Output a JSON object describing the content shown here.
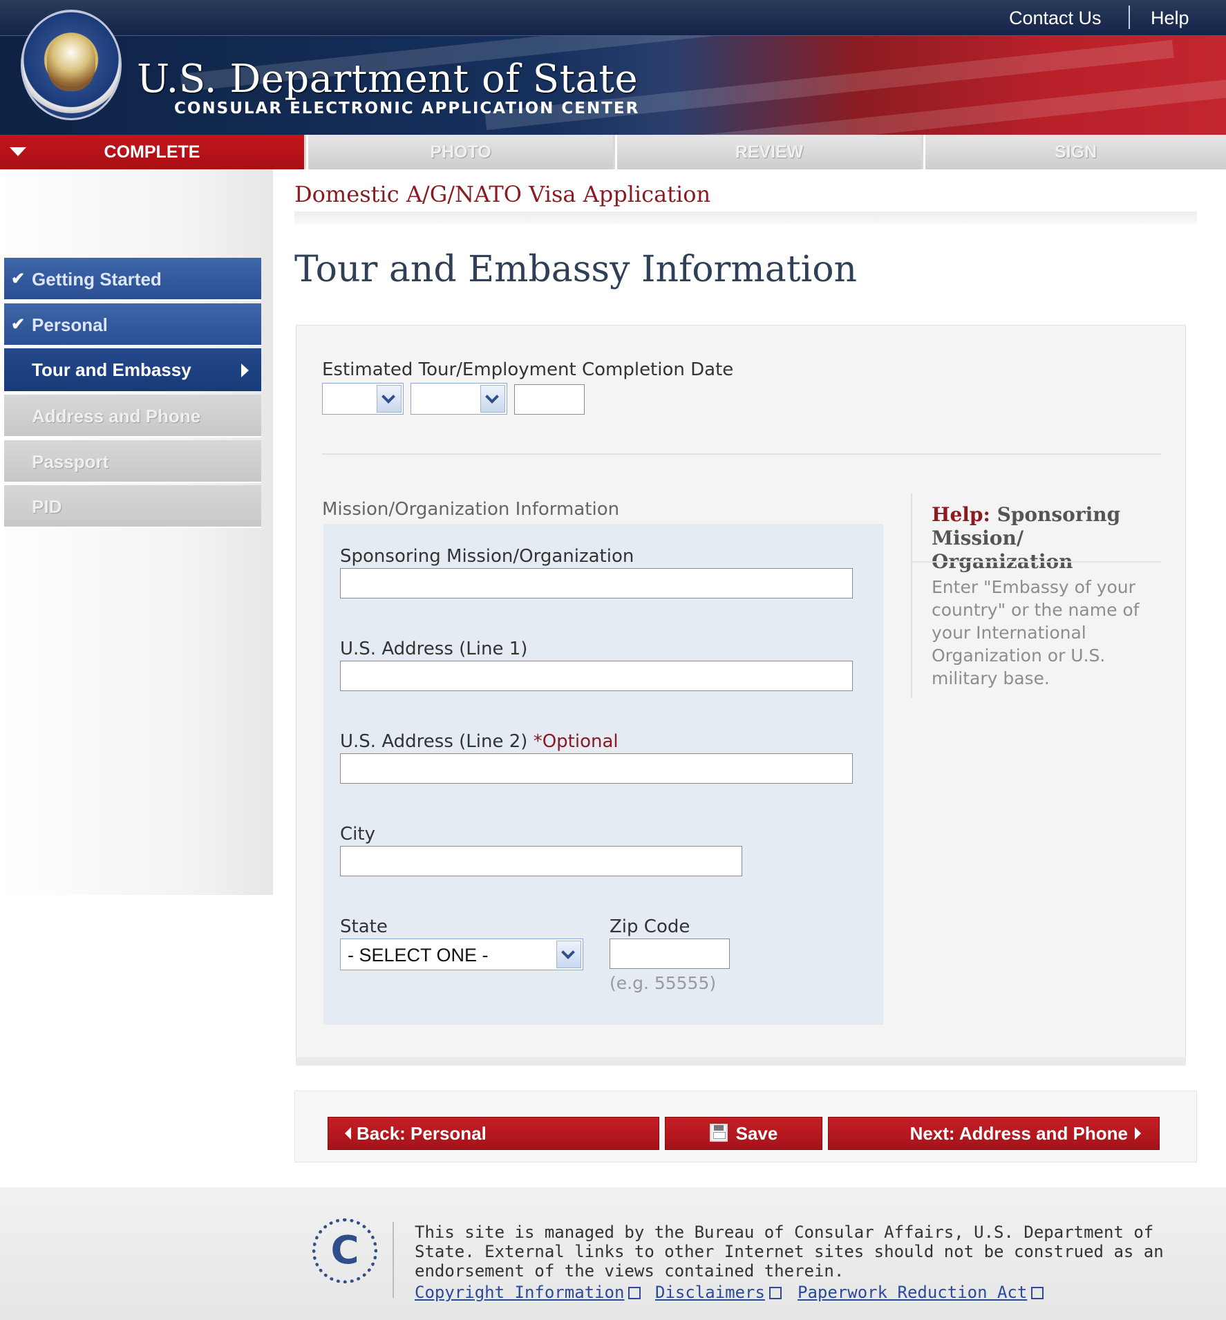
{
  "header": {
    "agency_title": "U.S. Department of State",
    "agency_subtitle": "CONSULAR ELECTRONIC APPLICATION CENTER",
    "links": {
      "contact": "Contact Us",
      "help": "Help"
    }
  },
  "steps": [
    {
      "label": "COMPLETE",
      "state": "active"
    },
    {
      "label": "PHOTO",
      "state": "disabled"
    },
    {
      "label": "REVIEW",
      "state": "disabled"
    },
    {
      "label": "SIGN",
      "state": "disabled"
    }
  ],
  "sidebar": {
    "items": [
      {
        "label": "Getting Started",
        "state": "done"
      },
      {
        "label": "Personal",
        "state": "done"
      },
      {
        "label": "Tour and Embassy",
        "state": "current"
      },
      {
        "label": "Address and Phone",
        "state": "disabled"
      },
      {
        "label": "Passport",
        "state": "disabled"
      },
      {
        "label": "PID",
        "state": "disabled"
      }
    ]
  },
  "main": {
    "application_title": "Domestic A/G/NATO Visa Application",
    "page_title": "Tour and Embassy Information",
    "completion_date": {
      "label": "Estimated Tour/Employment Completion Date",
      "day": "",
      "month": "",
      "year": ""
    },
    "mission": {
      "section_label": "Mission/Organization Information",
      "sponsoring_label": "Sponsoring Mission/Organization",
      "sponsoring_value": "",
      "address1_label": "U.S. Address (Line 1)",
      "address1_value": "",
      "address2_label": "U.S. Address (Line 2)",
      "address2_optional": "*Optional",
      "address2_value": "",
      "city_label": "City",
      "city_value": "",
      "state_label": "State",
      "state_value": "- SELECT ONE -",
      "zip_label": "Zip Code",
      "zip_value": "",
      "zip_hint": "(e.g. 55555)"
    },
    "help": {
      "prefix": "Help:",
      "title": "Sponsoring Mission/ Organization",
      "text": "Enter \"Embassy of your country\" or the name of your International Organization or U.S. military base."
    }
  },
  "buttons": {
    "back": "Back: Personal",
    "save": "Save",
    "next": "Next: Address and Phone"
  },
  "footer": {
    "logo_letter": "C",
    "text": "This site is managed by the Bureau of Consular Affairs, U.S. Department of State. External links to other Internet sites should not be construed as an endorsement of the views contained therein.",
    "links": {
      "copyright": "Copyright Information",
      "disclaimers": "Disclaimers",
      "paperwork": "Paperwork Reduction Act"
    }
  },
  "colors": {
    "navy": "#17315e",
    "brand_red": "#c4151c",
    "nav_blue": "#2a4f93",
    "accent_maroon": "#8a1b22"
  }
}
